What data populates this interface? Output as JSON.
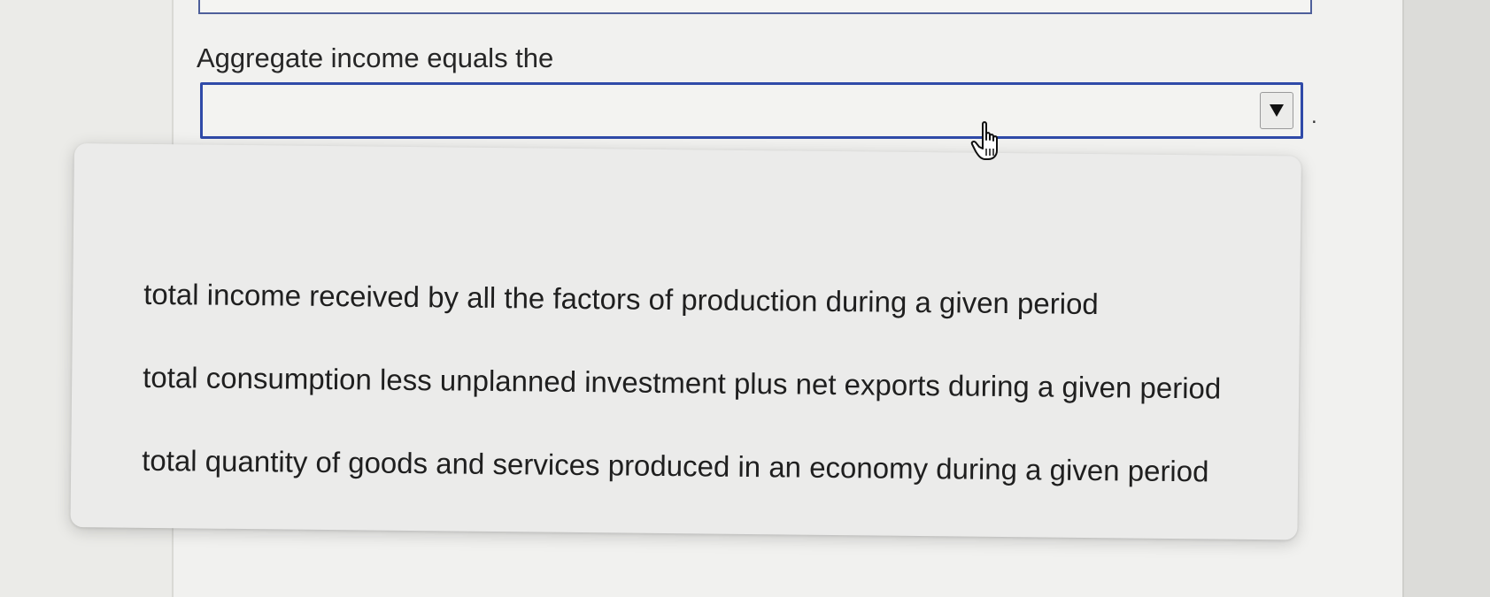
{
  "question": {
    "prompt": "Aggregate income equals the",
    "trailing_punctuation": "."
  },
  "select": {
    "selected_value": "",
    "arrow_icon": "triangle-down-icon"
  },
  "dropdown": {
    "options": [
      "total income received by all the factors of production during a given period",
      "total consumption less unplanned investment plus net exports during a given period",
      "total quantity of goods and services produced in an economy during a given period"
    ]
  },
  "colors": {
    "focus_border": "#2f4aa8",
    "menu_background": "#ebebea",
    "page_background": "#f1f1ef"
  }
}
